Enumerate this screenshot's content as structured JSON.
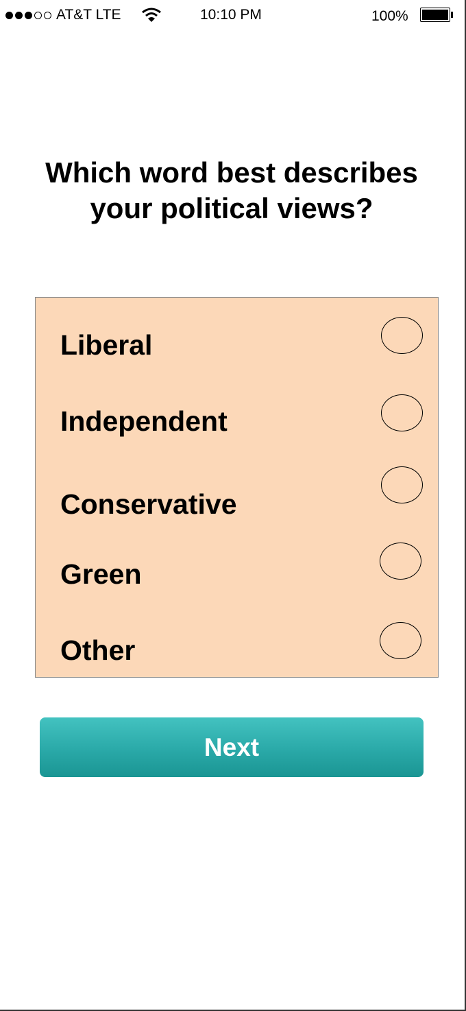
{
  "status_bar": {
    "carrier": "AT&T LTE",
    "signal_bars_filled": 3,
    "signal_bars_total": 5,
    "wifi_icon": "wifi-icon",
    "time": "10:10 PM",
    "battery_percent": "100%",
    "battery_icon": "battery-icon"
  },
  "question": {
    "text": "Which word best describes your political views?"
  },
  "options": [
    {
      "label": "Liberal",
      "selected": false
    },
    {
      "label": "Independent",
      "selected": false
    },
    {
      "label": "Conservative",
      "selected": false
    },
    {
      "label": "Green",
      "selected": false
    },
    {
      "label": "Other",
      "selected": false
    }
  ],
  "next_button": {
    "label": "Next"
  },
  "colors": {
    "options_background": "#fcd8b8",
    "button_teal": "#2aa9a8"
  }
}
